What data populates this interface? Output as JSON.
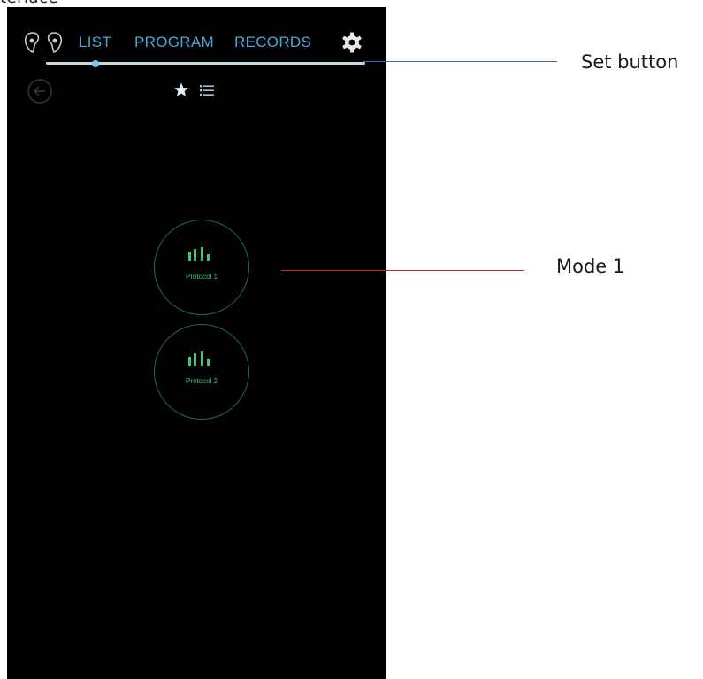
{
  "page": {
    "top_text": "teriace"
  },
  "nav": {
    "tabs": [
      {
        "label": "LIST"
      },
      {
        "label": "PROGRAM"
      },
      {
        "label": "RECORDS"
      }
    ],
    "active_tab": "LIST",
    "logo_icon": "earbuds-logo",
    "settings_icon": "gear-icon"
  },
  "toolbar": {
    "back_icon": "back-arrow-icon",
    "favorite_icon": "star-icon",
    "list_icon": "list-icon"
  },
  "protocols": [
    {
      "label": "Protocol 1",
      "icon": "bars-icon"
    },
    {
      "label": "Protocol 2",
      "icon": "bars-icon"
    }
  ],
  "callouts": {
    "set": "Set button",
    "mode": "Mode 1"
  },
  "colors": {
    "accent_blue": "#49a7d8",
    "accent_green": "#43c47c",
    "circle_border": "#1f6e4e",
    "set_line": "#3a6ea8",
    "mode_line": "#c62c18",
    "background": "#000000"
  }
}
